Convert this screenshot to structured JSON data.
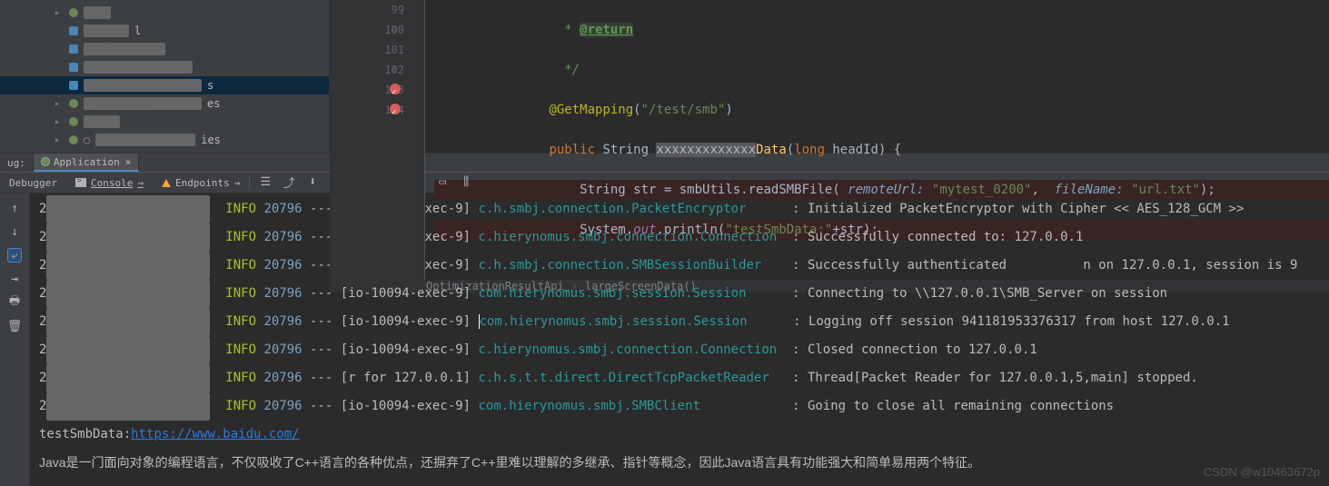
{
  "editor": {
    "lines": {
      "99": {
        "num": "99",
        "doc": " * ",
        "tag": "@return"
      },
      "100": {
        "num": "100",
        "doc": " */"
      },
      "101": {
        "num": "101",
        "ann": "@GetMapping",
        "paren_open": "(",
        "str": "\"/test/smb\"",
        "paren_close": ")"
      },
      "102": {
        "num": "102",
        "kw_public": "public ",
        "type": "String ",
        "method": "Data",
        "sig": "(",
        "kw_long": "long ",
        "pname": "headId",
        "sig2": ") {"
      },
      "103": {
        "num": "103",
        "type2": "String ",
        "var": "str = smbUtils.readSMBFile(",
        "p1": " remoteUrl: ",
        "s1": "\"mytest_0200\"",
        "c": ", ",
        "p2": " fileName: ",
        "s2": "\"url.txt\"",
        "end": ");"
      },
      "104": {
        "num": "104",
        "sys": "System.",
        "out": "out",
        "print": ".println(",
        "str": "\"testSmbData:\"",
        "cat": "+str);"
      }
    },
    "breadcrumb": {
      "file": "OptimizationResultApi",
      "method": "largeScreenData()"
    }
  },
  "panel": {
    "debug_label": "ug:",
    "app_tab": "Application",
    "debugger_tab": "Debugger",
    "console_tab": "Console",
    "endpoints_tab": "Endpoints"
  },
  "console": {
    "lines": [
      {
        "pre": "2",
        "level": "INFO",
        "pid": "20796",
        "sep": " --- ",
        "thread": "[io-10094-exec-9]",
        "logger": "c.h.smbj.connection.PacketEncryptor     ",
        "msg": ": Initialized PacketEncryptor with Cipher << AES_128_GCM >>"
      },
      {
        "pre": "2",
        "level": "INFO",
        "pid": "20796",
        "sep": " --- ",
        "thread": "[io-10094-exec-9]",
        "logger": "c.hierynomus.smbj.connection.Connection ",
        "msg": ": Successfully connected to: 127.0.0.1"
      },
      {
        "pre": "2",
        "level": "INFO",
        "pid": "20796",
        "sep": " --- ",
        "thread": "[io-10094-exec-9]",
        "logger": "c.h.smbj.connection.SMBSessionBuilder   ",
        "msg": ": Successfully authenticated          n on 127.0.0.1, session is 9"
      },
      {
        "pre": "2",
        "level": "INFO",
        "pid": "20796",
        "sep": " --- ",
        "thread": "[io-10094-exec-9]",
        "logger": "com.hierynomus.smbj.session.Session     ",
        "msg": ": Connecting to \\\\127.0.0.1\\SMB_Server on session "
      },
      {
        "pre": "2",
        "level": "INFO",
        "pid": "20796",
        "sep": " --- ",
        "thread": "[io-10094-exec-9]",
        "logger": "com.hierynomus.smbj.session.Session     ",
        "msg": ": Logging off session 941181953376317 from host 127.0.0.1"
      },
      {
        "pre": "2",
        "level": "INFO",
        "pid": "20796",
        "sep": " --- ",
        "thread": "[io-10094-exec-9]",
        "logger": "c.hierynomus.smbj.connection.Connection ",
        "msg": ": Closed connection to 127.0.0.1"
      },
      {
        "pre": "2",
        "level": "INFO",
        "pid": "20796",
        "sep": " --- ",
        "thread": "[r for 127.0.0.1]",
        "logger": "c.h.s.t.t.direct.DirectTcpPacketReader  ",
        "msg": ": Thread[Packet Reader for 127.0.0.1,5,main] stopped."
      },
      {
        "pre": "2",
        "level": "INFO",
        "pid": "20796",
        "sep": " --- ",
        "thread": "[io-10094-exec-9]",
        "logger": "com.hierynomus.smbj.SMBClient           ",
        "msg": ": Going to close all remaining connections"
      }
    ],
    "output_prefix": "testSmbData:",
    "output_link": "https://www.baidu.com/",
    "chinese_text": "Java是一门面向对象的编程语言，不仅吸收了C++语言的各种优点，还摒弃了C++里难以理解的多继承、指针等概念，因此Java语言具有功能强大和简单易用两个特征。"
  },
  "watermark": "CSDN @w10463672p"
}
